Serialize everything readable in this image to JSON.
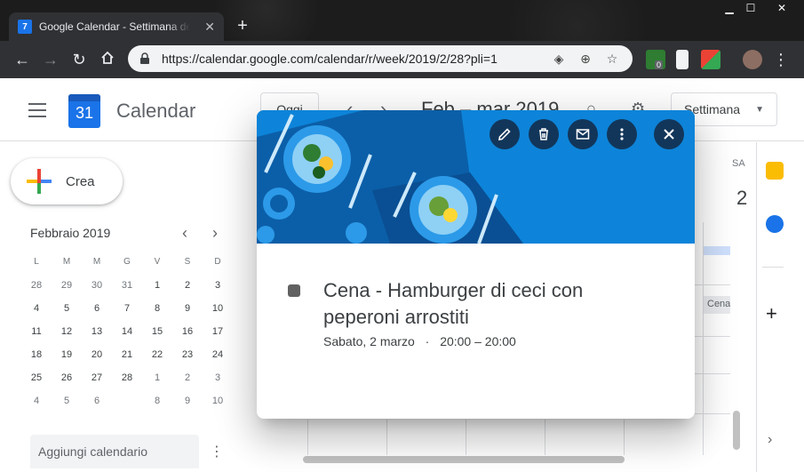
{
  "browser": {
    "tab_title": "Google Calendar - Settimana dell'",
    "tab_favicon": "7",
    "url": "https://calendar.google.com/calendar/r/week/2019/2/28?pli=1",
    "extension_badge": "0"
  },
  "header": {
    "app_title": "Calendar",
    "logo_text": "31",
    "today_label": "Oggi",
    "date_range": "Feb – mar 2019",
    "view_label": "Settimana"
  },
  "sidebar": {
    "create_label": "Crea",
    "mini_month": "Febbraio 2019",
    "weekdays": [
      "L",
      "M",
      "M",
      "G",
      "V",
      "S",
      "D"
    ],
    "weeks": [
      [
        "28",
        "29",
        "30",
        "31",
        "1",
        "2",
        "3"
      ],
      [
        "4",
        "5",
        "6",
        "7",
        "8",
        "9",
        "10"
      ],
      [
        "11",
        "12",
        "13",
        "14",
        "15",
        "16",
        "17"
      ],
      [
        "18",
        "19",
        "20",
        "21",
        "22",
        "23",
        "24"
      ],
      [
        "25",
        "26",
        "27",
        "28",
        "1",
        "2",
        "3"
      ],
      [
        "4",
        "5",
        "6",
        "7",
        "8",
        "9",
        "10"
      ]
    ],
    "add_calendar_placeholder": "Aggiungi calendario"
  },
  "grid": {
    "day_label": "SA",
    "day_number": "2",
    "event_chip": "Cena"
  },
  "popup": {
    "title": "Cena - Hamburger di ceci con peperoni arrostiti",
    "date": "Sabato, 2 marzo",
    "separator": "·",
    "time": "20:00 – 20:00",
    "event_color": "#616161"
  },
  "colors": {
    "accent": "#1a73e8",
    "banner": "#0d84d9",
    "popup_button": "#12365a"
  }
}
